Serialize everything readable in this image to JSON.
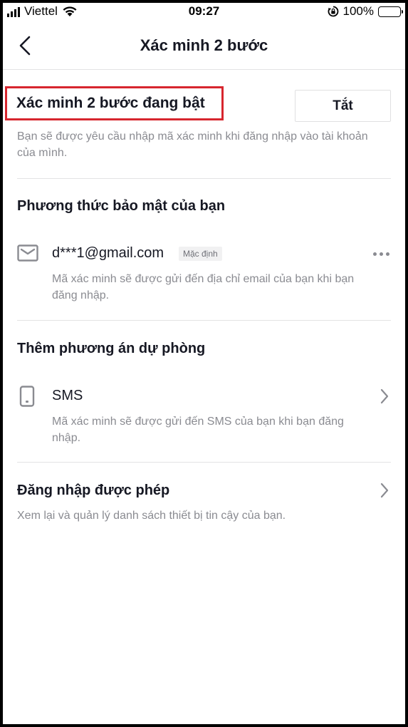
{
  "status_bar": {
    "carrier": "Viettel",
    "time": "09:27",
    "battery": "100%"
  },
  "nav": {
    "title": "Xác minh 2 bước"
  },
  "two_factor": {
    "status_text": "Xác minh 2 bước đang bật",
    "toggle_label": "Tắt",
    "description": "Bạn sẽ được yêu cầu nhập mã xác minh khi đăng nhập vào tài khoản của mình."
  },
  "security_methods": {
    "title": "Phương thức bảo mật của bạn",
    "email": {
      "address": "d***1@gmail.com",
      "badge": "Mặc định",
      "description": "Mã xác minh sẽ được gửi đến địa chỉ email của bạn khi bạn đăng nhập."
    }
  },
  "backup_methods": {
    "title": "Thêm phương án dự phòng",
    "sms": {
      "label": "SMS",
      "description": "Mã xác minh sẽ được gửi đến SMS của bạn khi bạn đăng nhập."
    }
  },
  "allowed_logins": {
    "title": "Đăng nhập được phép",
    "description": "Xem lại và quản lý danh sách thiết bị tin cậy của bạn."
  },
  "icons": {
    "back": "chevron-left-icon",
    "email": "envelope-icon",
    "sms": "phone-icon",
    "more": "more-horizontal-icon",
    "chevron": "chevron-right-icon"
  },
  "colors": {
    "highlight_border": "#d7262e",
    "secondary_text": "#8a8b91",
    "divider": "#e3e3e4"
  }
}
